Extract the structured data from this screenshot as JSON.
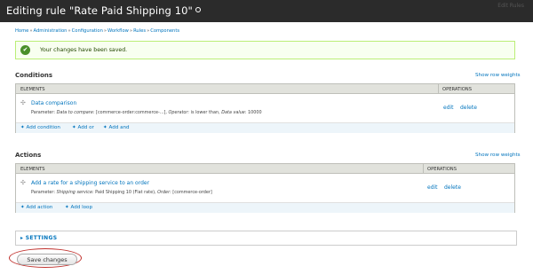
{
  "header": {
    "title": "Editing rule \"Rate Paid Shipping 10\"",
    "title_icon": "gear-icon",
    "right_text": "Edit     Rules"
  },
  "breadcrumb": [
    "Home",
    "Administration",
    "Configuration",
    "Workflow",
    "Rules",
    "Components"
  ],
  "status": {
    "icon": "check-icon",
    "message": "Your changes have been saved."
  },
  "conditions": {
    "title": "Conditions",
    "show_weights": "Show row weights",
    "col_elements": "ELEMENTS",
    "col_operations": "OPERATIONS",
    "rows": [
      {
        "name": "Data comparison",
        "param_prefix": "Parameter: ",
        "param_k1": "Data to compare:",
        "param_v1": " [commerce-order:commerce-...], ",
        "param_k2": "Operator:",
        "param_v2": " is lower than, ",
        "param_k3": "Data value:",
        "param_v3": " 10000",
        "edit": "edit",
        "delete": "delete"
      }
    ],
    "add_links": [
      "Add condition",
      "Add or",
      "Add and"
    ]
  },
  "actions": {
    "title": "Actions",
    "show_weights": "Show row weights",
    "col_elements": "ELEMENTS",
    "col_operations": "OPERATIONS",
    "rows": [
      {
        "name": "Add a rate for a shipping service to an order",
        "param_prefix": "Parameter: ",
        "param_k1": "Shipping service:",
        "param_v1": " Paid Shipping 10 (Flat rate), ",
        "param_k2": "Order:",
        "param_v2": " [commerce-order]",
        "edit": "edit",
        "delete": "delete"
      }
    ],
    "add_links": [
      "Add action",
      "Add loop"
    ]
  },
  "settings": {
    "label": "SETTINGS"
  },
  "save_button": "Save changes",
  "colors": {
    "header_bg": "#2b2b2b",
    "link": "#0074bd",
    "status_bg": "#f8fff0",
    "highlight_ellipse": "#c0302c"
  }
}
